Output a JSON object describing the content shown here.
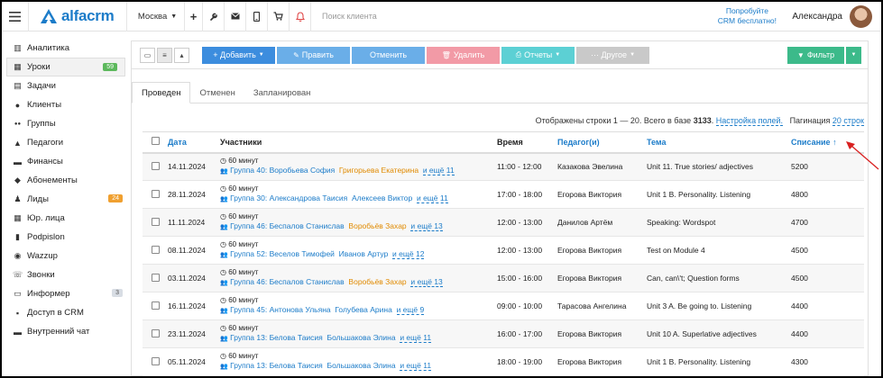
{
  "header": {
    "logo_text": "alfacrm",
    "city": "Москва",
    "search_placeholder": "Поиск клиента",
    "promo_line1": "Попробуйте",
    "promo_line2": "CRM бесплатно!",
    "user_name": "Александра"
  },
  "sidebar": {
    "items": [
      {
        "label": "Аналитика",
        "icon": "chart-icon"
      },
      {
        "label": "Уроки",
        "icon": "calendar-icon",
        "badge": "59",
        "badge_color": "#5cb85c",
        "active": true
      },
      {
        "label": "Задачи",
        "icon": "tasks-icon"
      },
      {
        "label": "Клиенты",
        "icon": "user-icon"
      },
      {
        "label": "Группы",
        "icon": "users-icon"
      },
      {
        "label": "Педагоги",
        "icon": "graduation-cap-icon"
      },
      {
        "label": "Финансы",
        "icon": "money-icon"
      },
      {
        "label": "Абонементы",
        "icon": "tag-icon"
      },
      {
        "label": "Лиды",
        "icon": "lead-icon",
        "badge": "24",
        "badge_color": "#f0a030"
      },
      {
        "label": "Юр. лица",
        "icon": "building-icon"
      },
      {
        "label": "Podpislon",
        "icon": "document-icon"
      },
      {
        "label": "Wazzup",
        "icon": "whatsapp-icon"
      },
      {
        "label": "Звонки",
        "icon": "phone-icon"
      },
      {
        "label": "Информер",
        "icon": "inbox-icon",
        "badge": "3",
        "badge_color": "#d8dde4"
      },
      {
        "label": "Доступ в CRM",
        "icon": "lock-icon"
      },
      {
        "label": "Внутренний чат",
        "icon": "chat-icon"
      }
    ]
  },
  "toolbar": {
    "add_label": "+ Добавить",
    "edit_label": "Править",
    "cancel_label": "Отменить",
    "delete_label": "Удалить",
    "reports_label": "Отчеты",
    "other_label": "··· Другое",
    "filter_label": "Фильтр",
    "colors": {
      "add": "#3c8dde",
      "edit": "#6aaee8",
      "cancel": "#6aaee8",
      "delete": "#f29aa6",
      "reports": "#5cd0d4",
      "other": "#c9c9c9",
      "filter": "#3cba8a"
    }
  },
  "tabs": [
    {
      "label": "Проведен",
      "active": true
    },
    {
      "label": "Отменен"
    },
    {
      "label": "Запланирован"
    }
  ],
  "info": {
    "prefix": "Отображены строки 1 — 20. Всего в базе",
    "total": "3133",
    "suffix": ".",
    "settings_link": "Настройка полей.",
    "pagination_label": "Пагинация",
    "pagination_link": "20 строк"
  },
  "table": {
    "headers": {
      "date": "Дата",
      "participants": "Участники",
      "time": "Время",
      "teacher": "Педагог(и)",
      "topic": "Тема",
      "charge": "Списание ↑"
    },
    "rows": [
      {
        "date": "14.11.2024",
        "duration": "60 минут",
        "group": "Группа 40: Воробьева София",
        "extra": "Григорьева Екатерина",
        "extra_color": "orange",
        "more": "и ещё 11",
        "time": "11:00 - 12:00",
        "teacher": "Казакова Эвелина",
        "topic": "Unit 11. True stories/ adjectives",
        "charge": "5200"
      },
      {
        "date": "28.11.2024",
        "duration": "60 минут",
        "group": "Группа 30: Александрова Таисия",
        "extra": "Алексеев Виктор",
        "extra_color": "blue",
        "more": "и ещё 11",
        "time": "17:00 - 18:00",
        "teacher": "Егорова Виктория",
        "topic": "Unit 1 B. Personality. Listening",
        "charge": "4800"
      },
      {
        "date": "11.11.2024",
        "duration": "60 минут",
        "group": "Группа 46: Беспалов Станислав",
        "extra": "Воробьёв Захар",
        "extra_color": "orange",
        "more": "и ещё 13",
        "time": "12:00 - 13:00",
        "teacher": "Данилов Артём",
        "topic": "Speaking: Wordspot",
        "charge": "4700"
      },
      {
        "date": "08.11.2024",
        "duration": "60 минут",
        "group": "Группа 52: Веселов Тимофей",
        "extra": "Иванов Артур",
        "extra_color": "blue",
        "more": "и ещё 12",
        "time": "12:00 - 13:00",
        "teacher": "Егорова Виктория",
        "topic": "Test on Module 4",
        "charge": "4500"
      },
      {
        "date": "03.11.2024",
        "duration": "60 минут",
        "group": "Группа 46: Беспалов Станислав",
        "extra": "Воробьёв Захар",
        "extra_color": "orange",
        "more": "и ещё 13",
        "time": "15:00 - 16:00",
        "teacher": "Егорова Виктория",
        "topic": "Can, can\\'t; Question forms",
        "charge": "4500"
      },
      {
        "date": "16.11.2024",
        "duration": "60 минут",
        "group": "Группа 45: Антонова Ульяна",
        "extra": "Голубева Арина",
        "extra_color": "blue",
        "more": "и ещё 9",
        "time": "09:00 - 10:00",
        "teacher": "Тарасова Ангелина",
        "topic": "Unit 3 A. Be going to. Listening",
        "charge": "4400"
      },
      {
        "date": "23.11.2024",
        "duration": "60 минут",
        "group": "Группа 13: Белова Таисия",
        "extra": "Большакова Элина",
        "extra_color": "blue",
        "more": "и ещё 11",
        "time": "16:00 - 17:00",
        "teacher": "Егорова Виктория",
        "topic": "Unit 10 A. Superlative adjectives",
        "charge": "4400"
      },
      {
        "date": "05.11.2024",
        "duration": "60 минут",
        "group": "Группа 13: Белова Таисия",
        "extra": "Большакова Элина",
        "extra_color": "blue",
        "more": "и ещё 11",
        "time": "18:00 - 19:00",
        "teacher": "Егорова Виктория",
        "topic": "Unit 1 B. Personality. Listening",
        "charge": "4300"
      }
    ]
  }
}
